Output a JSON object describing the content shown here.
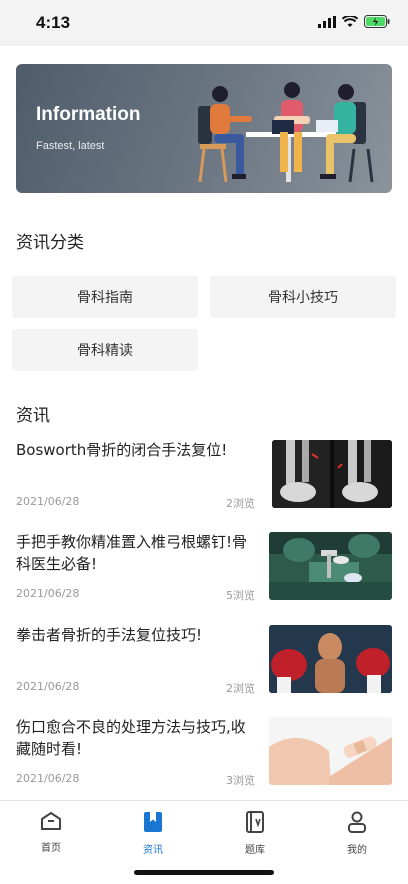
{
  "status_bar": {
    "time": "4:13"
  },
  "banner": {
    "title": "Information",
    "subtitle": "Fastest, latest"
  },
  "categories": {
    "title": "资讯分类",
    "items": [
      "骨科指南",
      "骨科小技巧",
      "骨科精读"
    ]
  },
  "news": {
    "title": "资讯",
    "items": [
      {
        "title": "Bosworth骨折的闭合手法复位!",
        "date": "2021/06/28",
        "views": "2浏览",
        "image": "x-ray-image"
      },
      {
        "title": "手把手教你精准置入椎弓根螺钉!骨科医生必备!",
        "date": "2021/06/28",
        "views": "5浏览",
        "image": "surgery-image"
      },
      {
        "title": "拳击者骨折的手法复位技巧!",
        "date": "2021/06/28",
        "views": "2浏览",
        "image": "boxer-image"
      },
      {
        "title": "伤口愈合不良的处理方法与技巧,收藏随时看!",
        "date": "2021/06/28",
        "views": "3浏览",
        "image": "bandage-image"
      }
    ]
  },
  "tabbar": {
    "items": [
      {
        "label": "首页",
        "icon": "home-icon"
      },
      {
        "label": "资讯",
        "icon": "bookmark-icon",
        "active": true
      },
      {
        "label": "题库",
        "icon": "question-bank-icon"
      },
      {
        "label": "我的",
        "icon": "user-icon"
      }
    ]
  },
  "colors": {
    "accent": "#1976d2"
  }
}
